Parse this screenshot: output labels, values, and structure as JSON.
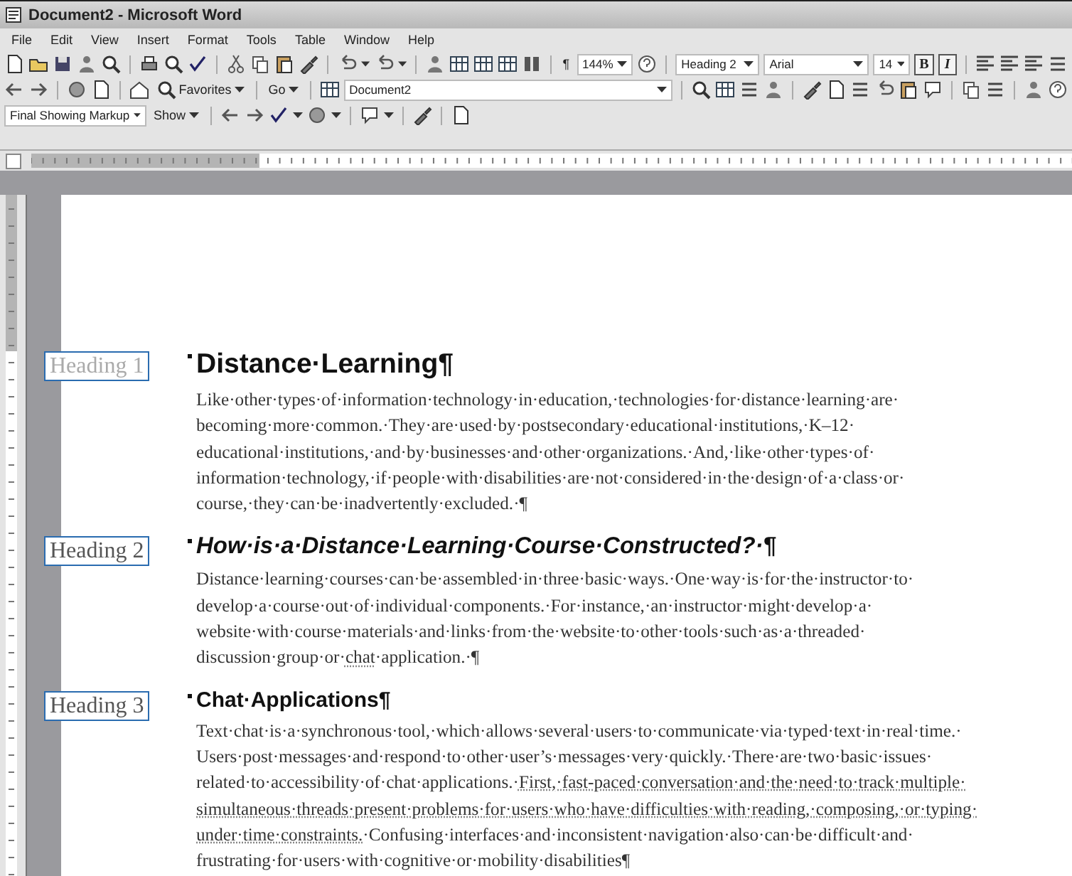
{
  "window": {
    "title": "Document2 - Microsoft Word"
  },
  "menu": [
    "File",
    "Edit",
    "View",
    "Insert",
    "Format",
    "Tools",
    "Table",
    "Window",
    "Help"
  ],
  "standard_toolbar": {
    "show_marks": "¶",
    "zoom": "144%"
  },
  "formatting_toolbar": {
    "style": "Heading 2",
    "font": "Arial",
    "size": "14",
    "bold": {
      "label": "B",
      "on": true
    },
    "italic": {
      "label": "I",
      "on": true
    }
  },
  "web_toolbar": {
    "favorites": "Favorites",
    "go": "Go",
    "address": "Document2"
  },
  "reviewing_toolbar": {
    "display": "Final Showing Markup",
    "show": "Show"
  },
  "sections": [
    {
      "style_label": "Heading 1",
      "label_dim": true,
      "heading": {
        "kind": "h1",
        "text": "Distance·Learning¶"
      },
      "paragraph": [
        {
          "text": "Like·other·types·of·information·technology·in·education,·technologies·for·distance·learning·are· becoming·more·common.·They·are·used·by·postsecondary·educational·institutions,·K–12· educational·institutions,·and·by·businesses·and·other·organizations.·And,·like·other·types·of· information·technology,·if·people·with·disabilities·are·not·considered·in·the·design·of·a·class·or· course,·they·can·be·inadvertently·excluded.·¶",
          "underlined": false
        }
      ]
    },
    {
      "style_label": "Heading 2",
      "label_dim": false,
      "heading": {
        "kind": "h2",
        "text": "How·is·a·Distance·Learning·Course·Constructed?·¶"
      },
      "paragraph": [
        {
          "text": "Distance·learning·courses·can·be·assembled·in·three·basic·ways.·One·way·is·for·the·instructor·to· develop·a·course·out·of·individual·components.·For·instance,·an·instructor·might·develop·a· website·with·course·materials·and·links·from·the·website·to·other·tools·such·as·a·threaded· discussion·group·or·",
          "underlined": false
        },
        {
          "text": "chat",
          "underlined": true
        },
        {
          "text": "·application.·¶",
          "underlined": false
        }
      ]
    },
    {
      "style_label": "Heading 3",
      "label_dim": false,
      "heading": {
        "kind": "h3",
        "text": "Chat·Applications¶"
      },
      "paragraph": [
        {
          "text": "Text·chat·is·a·synchronous·tool,·which·allows·several·users·to·communicate·via·typed·text·in·real·time.· Users·post·messages·and·respond·to·other·user’s·messages·very·quickly.·There·are·two·basic·issues· related·to·accessibility·of·chat·applications.·",
          "underlined": false
        },
        {
          "text": "First,·fast-paced·conversation·and·the·need·to·track·multiple· simultaneous·threads·present·problems·for·users·who·have·difficulties·with·reading,·composing,·or·typing· under·time·constraints.",
          "underlined": true
        },
        {
          "text": "·Confusing·interfaces·and·inconsistent·navigation·also·can·be·difficult·and· frustrating·for·users·with·cognitive·or·mobility·disabilities¶",
          "underlined": false
        }
      ]
    }
  ]
}
